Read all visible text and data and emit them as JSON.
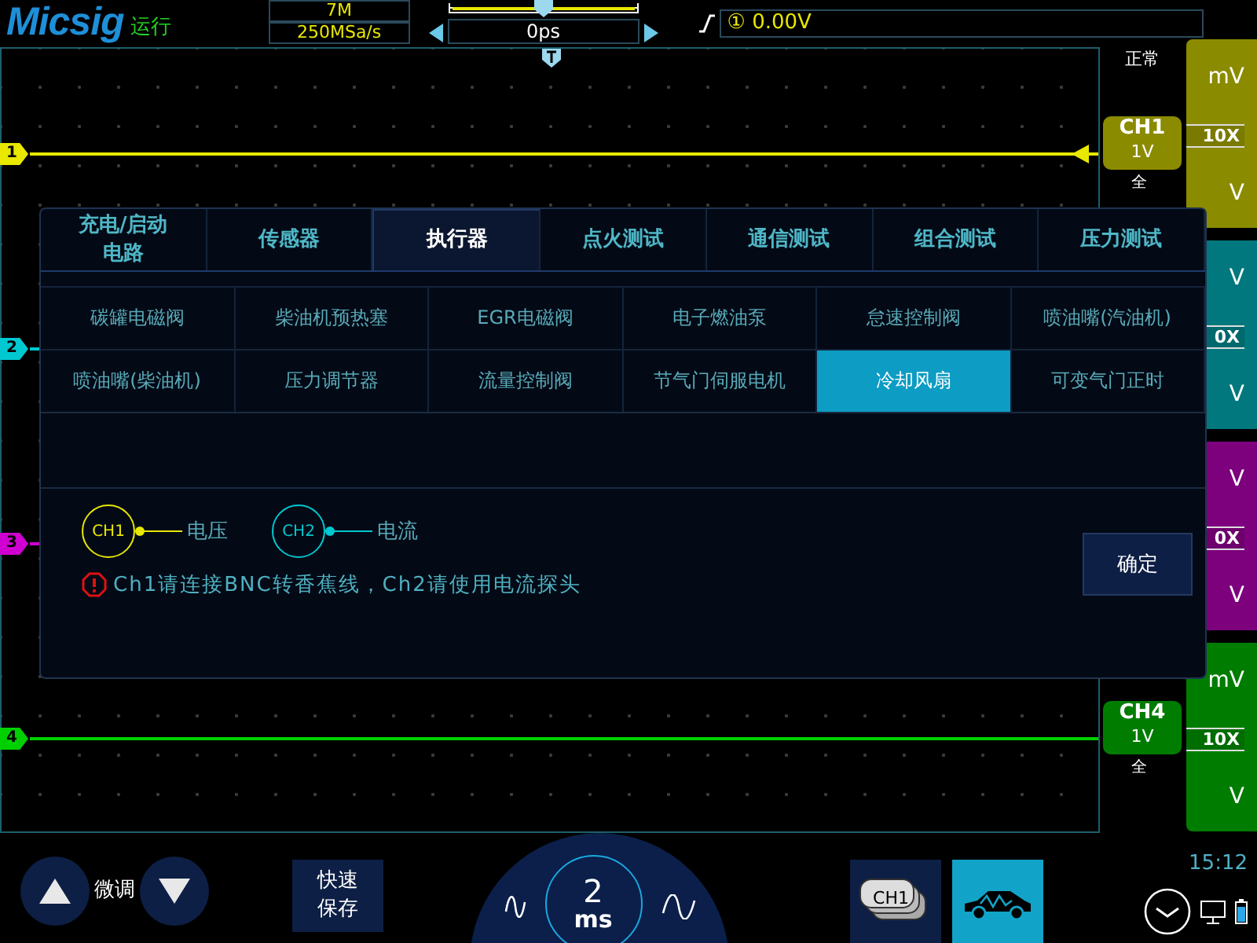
{
  "header": {
    "logo": "Micsig",
    "run_state": "运行",
    "memory_depth": "7M",
    "sample_rate": "250MSa/s",
    "time_offset": "0ps",
    "trigger_level": "① 0.00V"
  },
  "acquire_mode": "正常",
  "channels": [
    {
      "marker": "1",
      "color": "#e8e800",
      "scale_top": "mV",
      "probe": "10X",
      "scale_bottom": "V",
      "trigger": true,
      "tag": {
        "name": "CH1",
        "scale": "1V",
        "bandwidth": "全"
      }
    },
    {
      "marker": "2",
      "color": "#00c8d0",
      "scale_top": "V",
      "probe": "0X",
      "scale_bottom": "V"
    },
    {
      "marker": "3",
      "color": "#d000d0",
      "scale_top": "V",
      "probe": "0X",
      "scale_bottom": "V"
    },
    {
      "marker": "4",
      "color": "#00d000",
      "scale_top": "mV",
      "probe": "10X",
      "scale_bottom": "V",
      "tag": {
        "name": "CH4",
        "scale": "1V",
        "bandwidth": "全"
      }
    }
  ],
  "dialog": {
    "tabs": [
      {
        "label": "充电/启动电路",
        "selected": false
      },
      {
        "label": "传感器",
        "selected": false
      },
      {
        "label": "执行器",
        "selected": true
      },
      {
        "label": "点火测试",
        "selected": false
      },
      {
        "label": "通信测试",
        "selected": false
      },
      {
        "label": "组合测试",
        "selected": false
      },
      {
        "label": "压力测试",
        "selected": false
      }
    ],
    "items": [
      {
        "label": "碳罐电磁阀",
        "selected": false
      },
      {
        "label": "柴油机预热塞",
        "selected": false
      },
      {
        "label": "EGR电磁阀",
        "selected": false
      },
      {
        "label": "电子燃油泵",
        "selected": false
      },
      {
        "label": "怠速控制阀",
        "selected": false
      },
      {
        "label": "喷油嘴(汽油机)",
        "selected": false
      },
      {
        "label": "喷油嘴(柴油机)",
        "selected": false
      },
      {
        "label": "压力调节器",
        "selected": false
      },
      {
        "label": "流量控制阀",
        "selected": false
      },
      {
        "label": "节气门伺服电机",
        "selected": false
      },
      {
        "label": "冷却风扇",
        "selected": true
      },
      {
        "label": "可变气门正时",
        "selected": false
      }
    ],
    "legend": [
      {
        "channel": "CH1",
        "color": "#e8e800",
        "label": "电压"
      },
      {
        "channel": "CH2",
        "color": "#00c8d0",
        "label": "电流"
      }
    ],
    "warning": "Ch1请连接BNC转香蕉线，Ch2请使用电流探头",
    "confirm": "确定"
  },
  "footer": {
    "fine_tune": "微调",
    "quick_save": "快速保存",
    "time_scale_value": "2",
    "time_scale_unit": "ms",
    "channel_button": "CH1",
    "car_button_selected": true,
    "clock": "15:12"
  }
}
